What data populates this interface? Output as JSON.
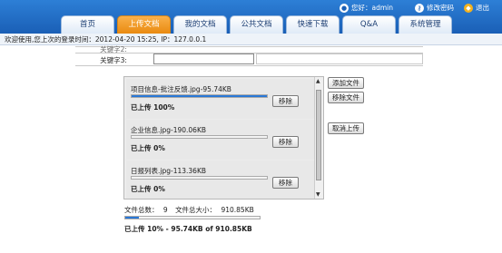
{
  "nav": {
    "tabs": [
      {
        "label": "首页"
      },
      {
        "label": "上传文档"
      },
      {
        "label": "我的文档"
      },
      {
        "label": "公共文档"
      },
      {
        "label": "快速下载"
      },
      {
        "label": "Q&A"
      },
      {
        "label": "系统管理"
      }
    ],
    "active_tab": "上传文档",
    "user_greeting": "您好：admin",
    "change_password": "修改密码",
    "logout": "退出"
  },
  "welcome_text": "欢迎使用,您上次的登录时间：2012-04-20 15:25, IP：127.0.0.1",
  "form": {
    "row_above_label": "关键字2:",
    "keyword3_label": "关键字3:"
  },
  "queue": {
    "items": [
      {
        "name": "项目信息-批注反馈.jpg-95.74KB",
        "progress": 1.0,
        "status": "已上传 100%",
        "remove": "移除"
      },
      {
        "name": "企业信息.jpg-190.06KB",
        "progress": 0.0,
        "status": "已上传 0%",
        "remove": "移除"
      },
      {
        "name": "日报列表.jpg-113.36KB",
        "progress": 0.0,
        "status": "已上传 0%",
        "remove": "移除"
      }
    ]
  },
  "actions": {
    "add_files": "添加文件",
    "remove_files": "移除文件",
    "cancel_upload": "取消上传"
  },
  "summary": {
    "file_count_label": "文件总数：",
    "file_count": "9",
    "total_size_label": "文件总大小：",
    "total_size": "910.85KB",
    "overall_progress": 0.1,
    "overall_status": "已上传 10% - 95.74KB of 910.85KB"
  },
  "colors": {
    "header": "#1a5fb6",
    "active_tab": "#e98a10",
    "progress": "#2a78d6"
  }
}
